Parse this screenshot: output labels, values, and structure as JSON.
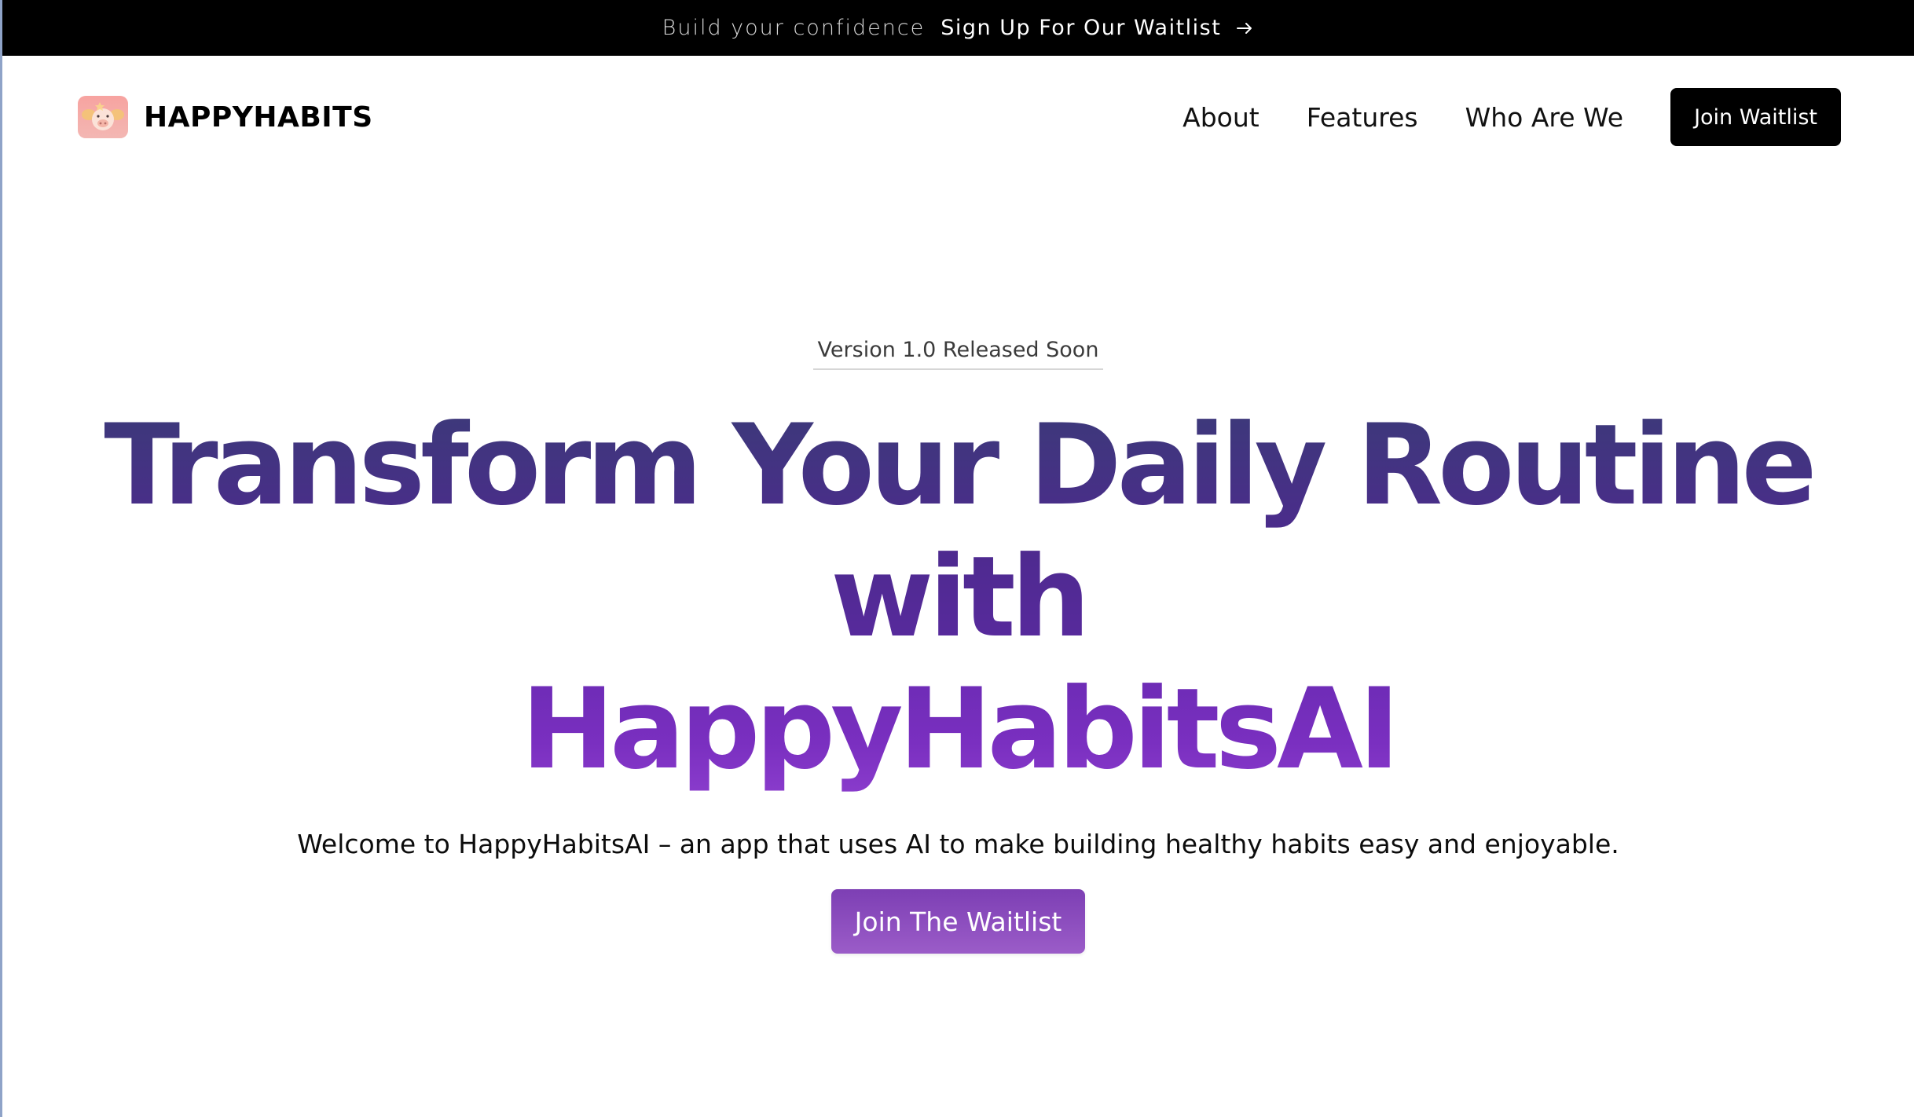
{
  "announcement": {
    "text": "Build your confidence",
    "link_label": "Sign Up For Our Waitlist",
    "link_icon": "arrow-right-icon"
  },
  "header": {
    "brand_name": "HAPPYHABITS",
    "logo_icon": "pig-logo-icon",
    "nav": [
      {
        "label": "About"
      },
      {
        "label": "Features"
      },
      {
        "label": "Who Are We"
      }
    ],
    "cta_label": "Join Waitlist"
  },
  "hero": {
    "version_badge": "Version 1.0 Released Soon",
    "title_line1": "Transform Your Daily Routine with",
    "title_line2": "HappyHabitsAI",
    "subtitle": "Welcome to HappyHabitsAI – an app that uses AI to make building healthy habits easy and enjoyable.",
    "cta_label": "Join The Waitlist"
  },
  "colors": {
    "announcement_bg": "#000000",
    "nav_cta_bg": "#000000",
    "title_gradient_top": "#3b3a78",
    "title_gradient_bottom": "#7a2fc0",
    "hero_cta_gradient": [
      "#7d3fb4",
      "#9b5cc8"
    ]
  }
}
